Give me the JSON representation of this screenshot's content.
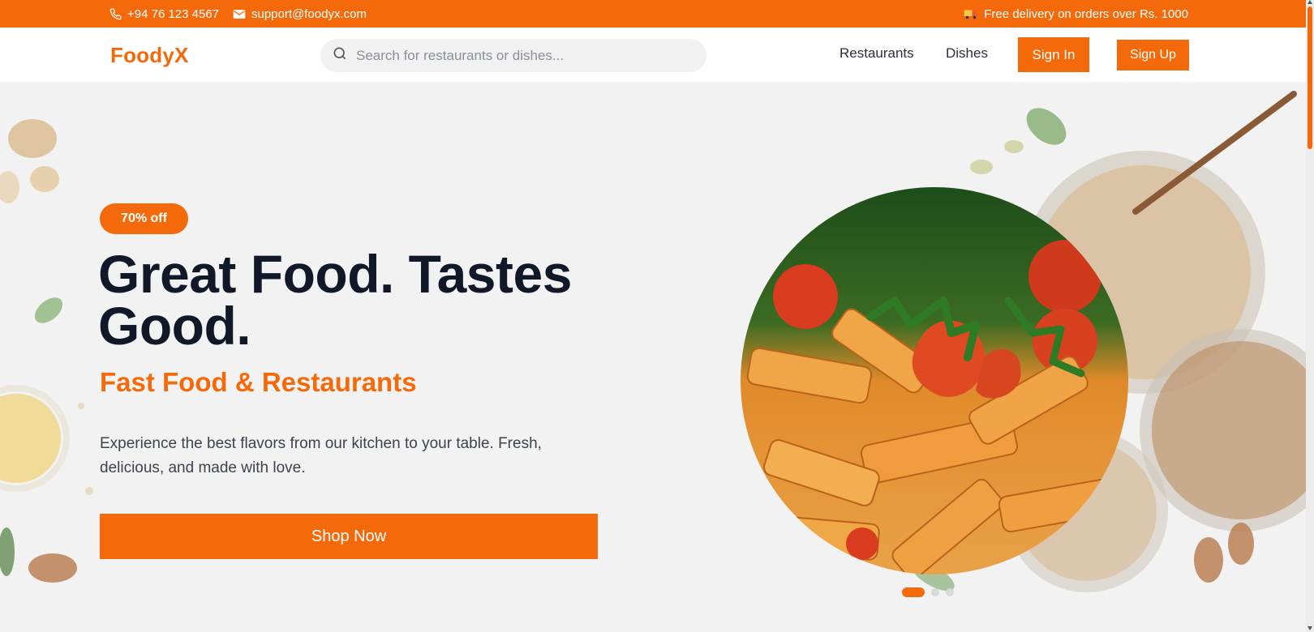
{
  "topbar": {
    "phone": "+94 76 123 4567",
    "email": "support@foodyx.com",
    "delivery": "Free delivery on orders over Rs. 1000"
  },
  "nav": {
    "logo": "FoodyX",
    "search_placeholder": "Search for restaurants or dishes...",
    "links": [
      "Restaurants",
      "Dishes"
    ],
    "signin": "Sign In",
    "signup": "Sign Up"
  },
  "hero": {
    "badge": "70% off",
    "headline": "Great Food. Tastes Good.",
    "subheadline": "Fast Food & Restaurants",
    "description": "Experience the best flavors from our kitchen to your table. Fresh, delicious, and made with love.",
    "cta": "Shop Now",
    "carousel": {
      "slides": 3,
      "active": 1
    }
  },
  "colors": {
    "accent": "#f46a0a",
    "heading": "#111827",
    "text": "#3d434d",
    "background": "#f2f2f3"
  },
  "icons": [
    "phone-icon",
    "mail-icon",
    "truck-icon",
    "search-icon"
  ]
}
